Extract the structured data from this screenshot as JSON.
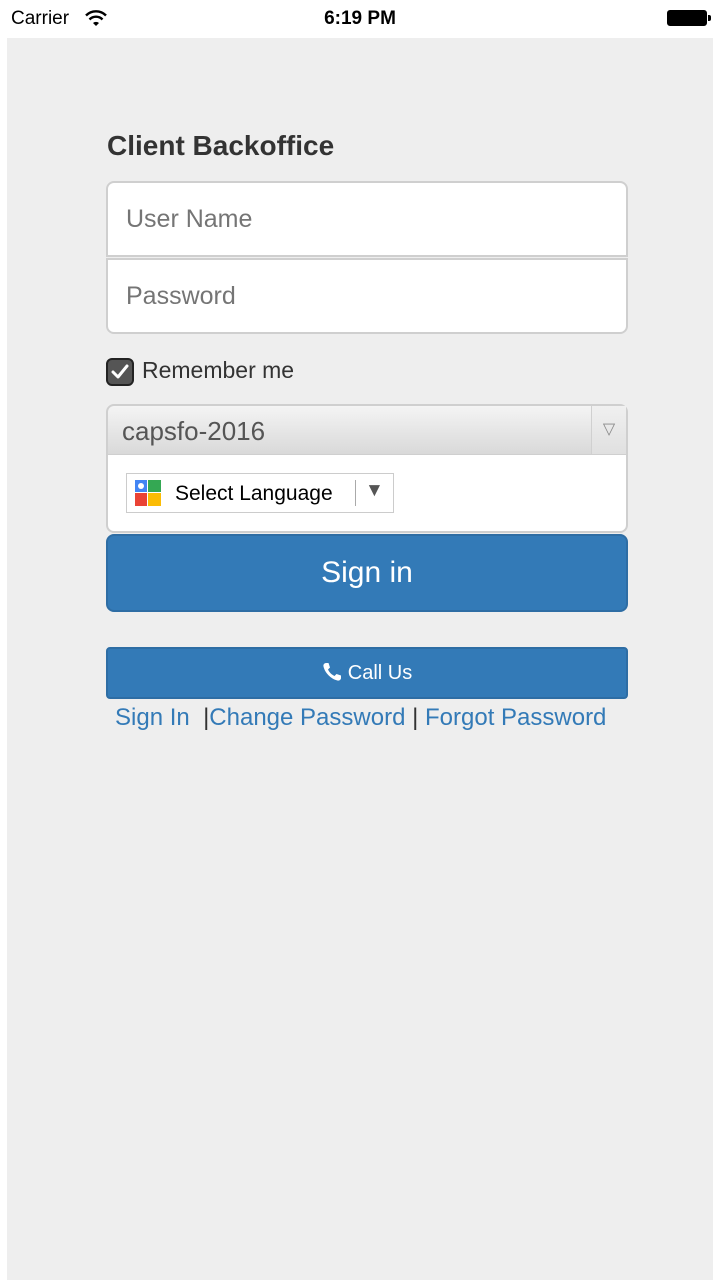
{
  "status_bar": {
    "carrier": "Carrier",
    "time": "6:19 PM"
  },
  "title": "Client Backoffice",
  "login": {
    "username_placeholder": "User Name",
    "password_placeholder": "Password",
    "remember_label": "Remember me",
    "remember_checked": true
  },
  "database_select": {
    "value": "capsfo-2016"
  },
  "language": {
    "label": "Select Language"
  },
  "buttons": {
    "sign_in": "Sign in",
    "call_us": "Call Us"
  },
  "links": {
    "sign_in": "Sign In",
    "change_password": "Change Password",
    "forgot_password": "Forgot Password",
    "separator": "|"
  },
  "colors": {
    "primary": "#337ab7",
    "background": "#eeeeee"
  }
}
